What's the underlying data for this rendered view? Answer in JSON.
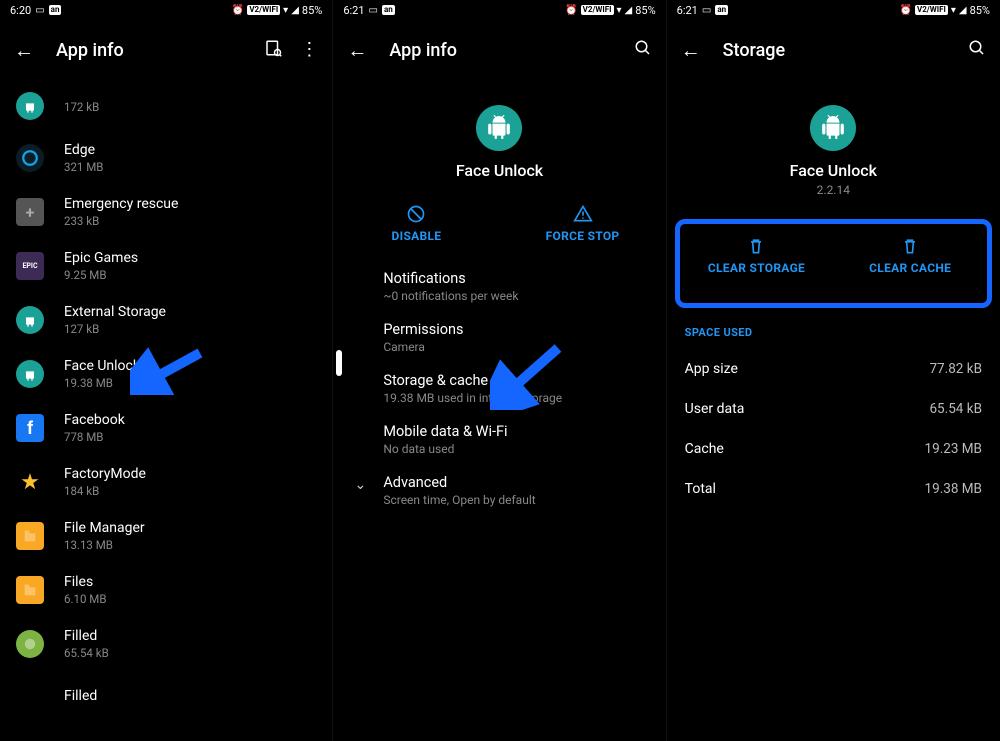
{
  "panel1": {
    "status": {
      "time": "6:20",
      "badge1": "an",
      "extra": "V2/WIFI",
      "battery": "85%"
    },
    "header": {
      "title": "App info"
    },
    "apps": [
      {
        "name": "",
        "sub": "172 kB",
        "bg": "#1ba196",
        "glyph": "android"
      },
      {
        "name": "Edge",
        "sub": "321 MB",
        "bg": "#0b1c26",
        "glyph": "edge"
      },
      {
        "name": "Emergency rescue",
        "sub": "233 kB",
        "bg": "#555",
        "glyph": "plus"
      },
      {
        "name": "Epic Games",
        "sub": "9.25 MB",
        "bg": "#3d2a55",
        "glyph": "epic"
      },
      {
        "name": "External Storage",
        "sub": "127 kB",
        "bg": "#1ba196",
        "glyph": "android"
      },
      {
        "name": "Face Unlock",
        "sub": "19.38 MB",
        "bg": "#1ba196",
        "glyph": "android"
      },
      {
        "name": "Facebook",
        "sub": "778 MB",
        "bg": "#1877f2",
        "glyph": "fb"
      },
      {
        "name": "FactoryMode",
        "sub": "184 kB",
        "bg": "none",
        "glyph": "star"
      },
      {
        "name": "File Manager",
        "sub": "13.13 MB",
        "bg": "#f9a825",
        "glyph": "folder"
      },
      {
        "name": "Files",
        "sub": "6.10 MB",
        "bg": "#f9a825",
        "glyph": "folder"
      },
      {
        "name": "Filled",
        "sub": "65.54 kB",
        "bg": "#7cb342",
        "glyph": "circle"
      },
      {
        "name": "Filled",
        "sub": "",
        "bg": "#1ba196",
        "glyph": "invis"
      }
    ]
  },
  "panel2": {
    "status": {
      "time": "6:21",
      "badge1": "an",
      "extra": "V2/WIFI",
      "battery": "85%"
    },
    "header": {
      "title": "App info"
    },
    "app": {
      "name": "Face Unlock"
    },
    "actions": {
      "disable": "DISABLE",
      "forcestop": "FORCE STOP"
    },
    "rows": [
      {
        "title": "Notifications",
        "sub": "~0 notifications per week"
      },
      {
        "title": "Permissions",
        "sub": "Camera"
      },
      {
        "title": "Storage & cache",
        "sub": "19.38 MB used in internal storage"
      },
      {
        "title": "Mobile data & Wi-Fi",
        "sub": "No data used"
      }
    ],
    "advanced": {
      "title": "Advanced",
      "sub": "Screen time, Open by default"
    }
  },
  "panel3": {
    "status": {
      "time": "6:21",
      "badge1": "an",
      "extra": "V2/WIFI",
      "battery": "85%"
    },
    "header": {
      "title": "Storage"
    },
    "app": {
      "name": "Face Unlock",
      "version": "2.2.14"
    },
    "actions": {
      "clearstorage": "CLEAR STORAGE",
      "clearcache": "CLEAR CACHE"
    },
    "section": "SPACE USED",
    "rows": [
      {
        "label": "App size",
        "value": "77.82 kB"
      },
      {
        "label": "User data",
        "value": "65.54 kB"
      },
      {
        "label": "Cache",
        "value": "19.23 MB"
      },
      {
        "label": "Total",
        "value": "19.38 MB"
      }
    ]
  }
}
